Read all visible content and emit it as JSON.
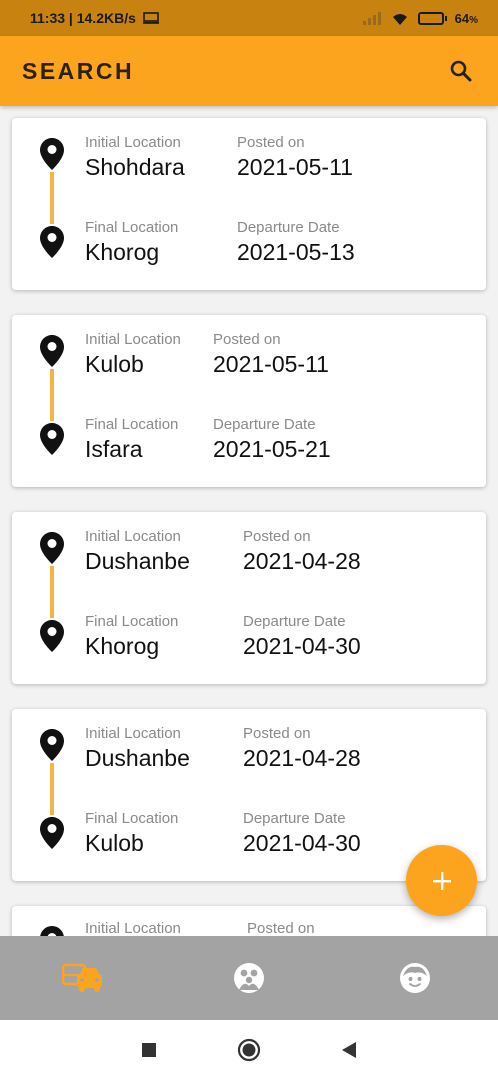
{
  "status_bar": {
    "time_speed": "11:33 | 14.2KB/s",
    "battery_percent": "64",
    "battery_suffix": "%",
    "battery_level": 0.64
  },
  "app_bar": {
    "title": "SEARCH",
    "search_icon": "search-icon"
  },
  "labels": {
    "initial_location": "Initial Location",
    "posted_on": "Posted on",
    "final_location": "Final Location",
    "departure_date": "Departure Date"
  },
  "cards": [
    {
      "initial": "Shohdara",
      "posted": "2021-05-11",
      "final": "Khorog",
      "departure": "2021-05-13"
    },
    {
      "initial": "Kulob",
      "posted": "2021-05-11",
      "final": "Isfara",
      "departure": "2021-05-21"
    },
    {
      "initial": "Dushanbe",
      "posted": "2021-04-28",
      "final": "Khorog",
      "departure": "2021-04-30"
    },
    {
      "initial": "Dushanbe",
      "posted": "2021-04-28",
      "final": "Kulob",
      "departure": "2021-04-30"
    },
    {
      "initial": "",
      "posted": "",
      "final": "",
      "departure": ""
    }
  ],
  "fab": {
    "icon": "plus-icon"
  },
  "bottom_nav": {
    "items": [
      {
        "icon": "rides-icon",
        "active": true
      },
      {
        "icon": "group-face-icon",
        "active": false
      },
      {
        "icon": "profile-face-icon",
        "active": false
      }
    ]
  },
  "colors": {
    "accent": "#fda41e",
    "status_bar": "#c8820f",
    "connector": "#f0b747",
    "nav_bg": "#a3a3a3"
  }
}
